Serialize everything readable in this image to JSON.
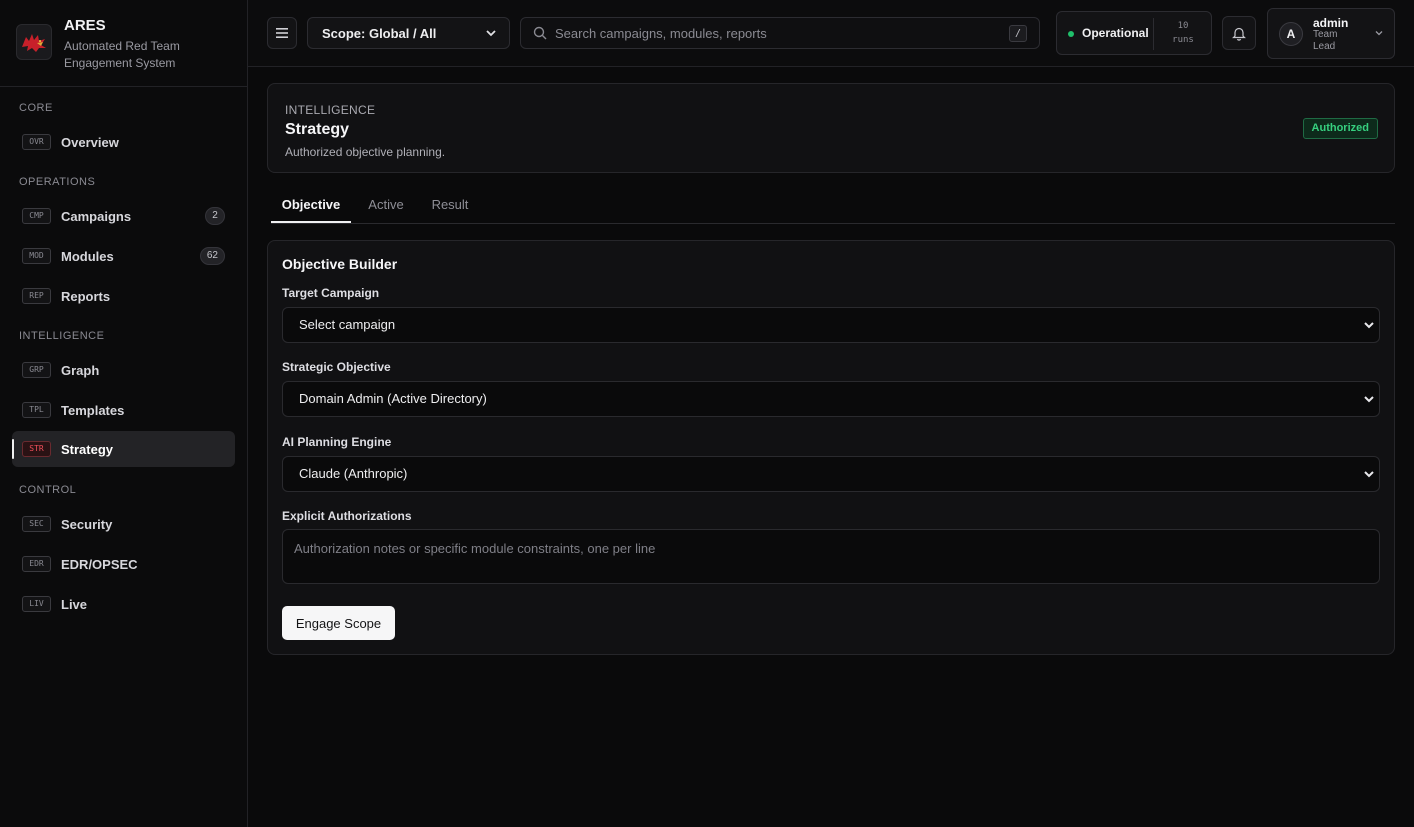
{
  "app": {
    "name": "ARES",
    "subtitle": "Automated Red Team Engagement System"
  },
  "sidebar": {
    "sections": [
      {
        "label": "CORE"
      },
      {
        "label": "OPERATIONS"
      },
      {
        "label": "INTELLIGENCE"
      },
      {
        "label": "CONTROL"
      }
    ],
    "items": [
      {
        "code": "OVR",
        "label": "Overview"
      },
      {
        "code": "CMP",
        "label": "Campaigns",
        "badge": "2"
      },
      {
        "code": "MOD",
        "label": "Modules",
        "badge": "62"
      },
      {
        "code": "REP",
        "label": "Reports"
      },
      {
        "code": "GRP",
        "label": "Graph"
      },
      {
        "code": "TPL",
        "label": "Templates"
      },
      {
        "code": "STR",
        "label": "Strategy",
        "active": true
      },
      {
        "code": "SEC",
        "label": "Security"
      },
      {
        "code": "EDR",
        "label": "EDR/OPSEC"
      },
      {
        "code": "LIV",
        "label": "Live"
      }
    ]
  },
  "topbar": {
    "scope": "Scope: Global / All",
    "search_placeholder": "Search campaigns, modules, reports",
    "search_shortcut": "/",
    "status": "Operational",
    "runs_count": "10",
    "runs_label": "runs",
    "user": {
      "initial": "A",
      "name": "admin",
      "role": "Team Lead"
    }
  },
  "header": {
    "eyebrow": "INTELLIGENCE",
    "title": "Strategy",
    "subtitle": "Authorized objective planning.",
    "badge": "Authorized"
  },
  "tabs": [
    {
      "label": "Objective",
      "active": true
    },
    {
      "label": "Active"
    },
    {
      "label": "Result"
    }
  ],
  "form": {
    "title": "Objective Builder",
    "target_label": "Target Campaign",
    "target_value": "Select campaign",
    "objective_label": "Strategic Objective",
    "objective_value": "Domain Admin (Active Directory)",
    "engine_label": "AI Planning Engine",
    "engine_value": "Claude (Anthropic)",
    "auth_label": "Explicit Authorizations",
    "auth_placeholder": "Authorization notes or specific module constraints, one per line",
    "submit_label": "Engage Scope"
  },
  "colors": {
    "accent_red": "#ef4f5a",
    "status_green": "#1fbf6a",
    "background": "#0a0a0b"
  }
}
